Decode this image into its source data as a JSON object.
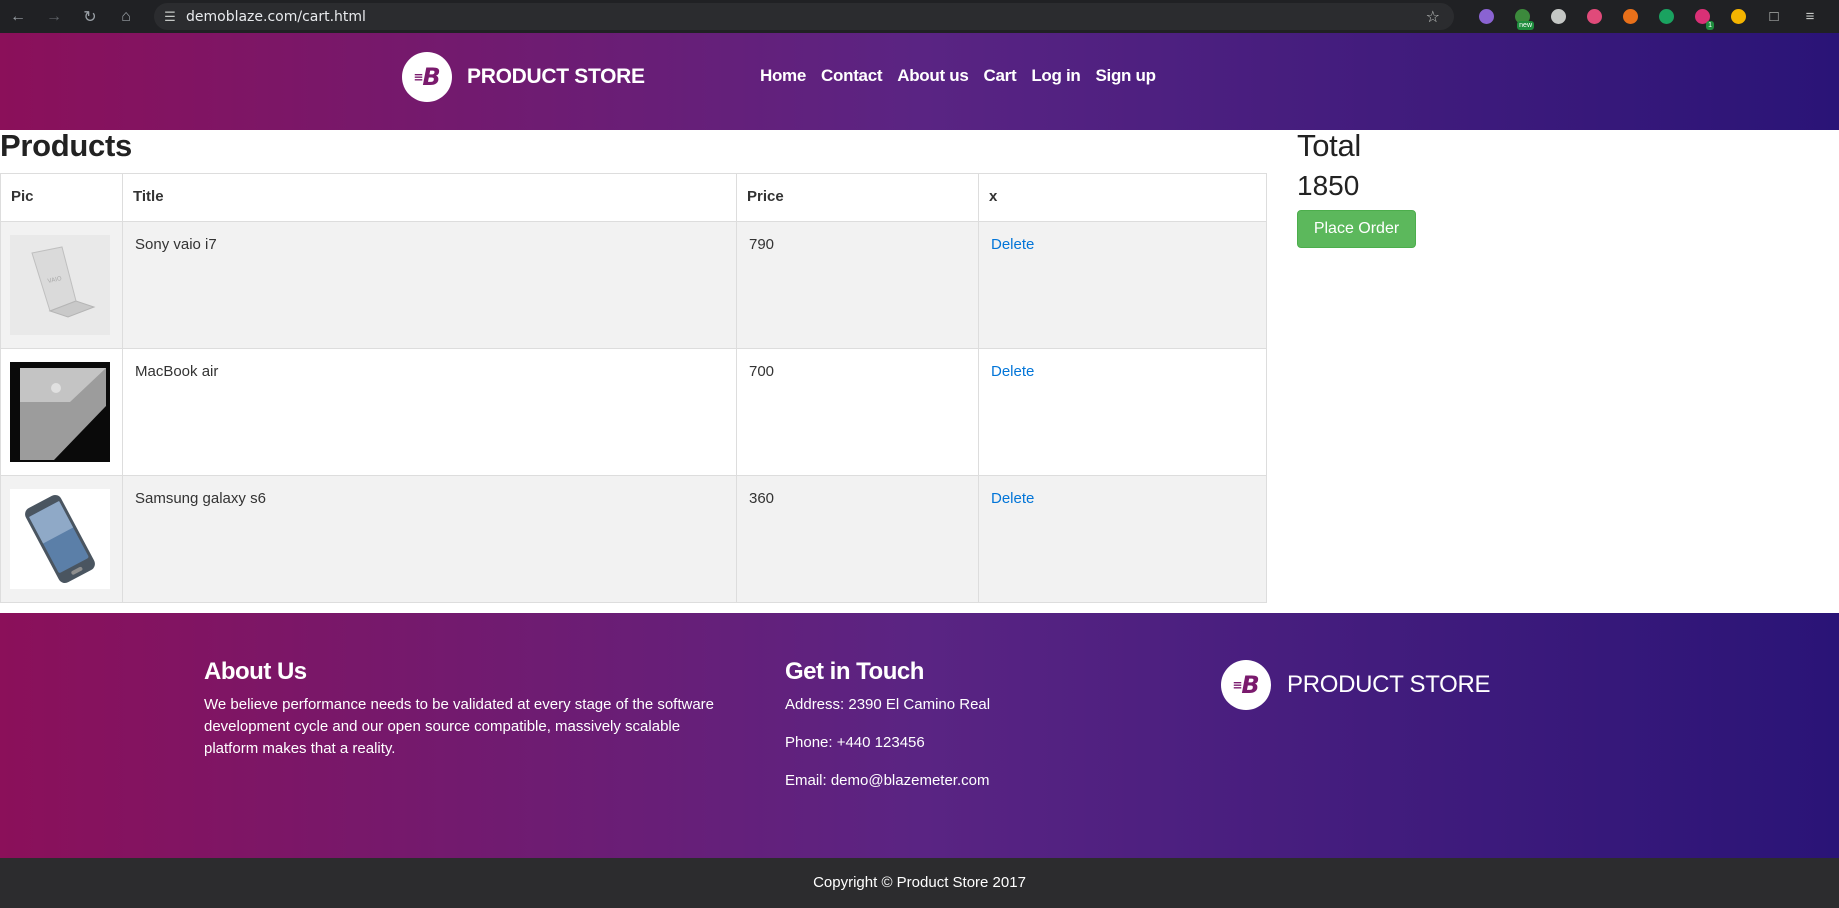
{
  "browser": {
    "url": "demoblaze.com/cart.html",
    "extensions": [
      {
        "icon": "puzzle-gear-icon",
        "color": "#8a63d2"
      },
      {
        "icon": "new-badge-icon",
        "color": "#3c8a3c",
        "badge": "new"
      },
      {
        "icon": "eyedropper-icon",
        "color": "#c4c7c5"
      },
      {
        "icon": "color-ring-icon",
        "color": "#e04a7a"
      },
      {
        "icon": "fox-icon",
        "color": "#e8701a"
      },
      {
        "icon": "shield-check-icon",
        "color": "#1aa260"
      },
      {
        "icon": "clip-icon",
        "color": "#d93076",
        "badge": "1"
      },
      {
        "icon": "coin-icon",
        "color": "#f4b400"
      }
    ]
  },
  "header": {
    "brand": "PRODUCT STORE",
    "nav": [
      "Home",
      "Contact",
      "About us",
      "Cart",
      "Log in",
      "Sign up"
    ]
  },
  "cart": {
    "title": "Products",
    "columns": [
      "Pic",
      "Title",
      "Price",
      "x"
    ],
    "rows": [
      {
        "title": "Sony vaio i7",
        "price": "790",
        "action": "Delete"
      },
      {
        "title": "MacBook air",
        "price": "700",
        "action": "Delete"
      },
      {
        "title": "Samsung galaxy s6",
        "price": "360",
        "action": "Delete"
      }
    ]
  },
  "summary": {
    "label": "Total",
    "value": "1850",
    "button": "Place Order"
  },
  "footer": {
    "about_title": "About Us",
    "about_text": "We believe performance needs to be validated at every stage of the software development cycle and our open source compatible, massively scalable platform makes that a reality.",
    "contact_title": "Get in Touch",
    "address": "Address: 2390 El Camino Real",
    "phone": "Phone: +440 123456",
    "email": "Email: demo@blazemeter.com",
    "brand": "PRODUCT STORE",
    "copyright": "Copyright © Product Store 2017"
  }
}
